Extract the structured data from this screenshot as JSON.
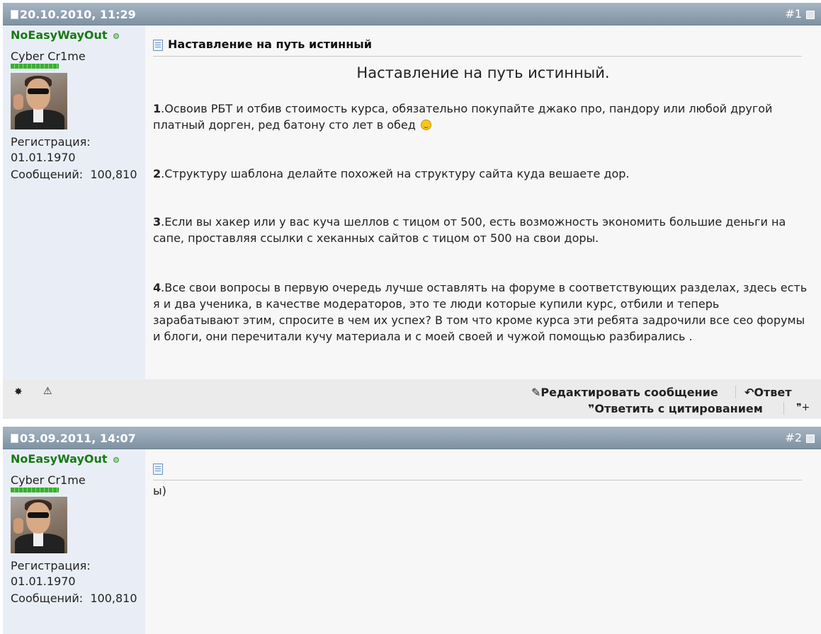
{
  "posts": [
    {
      "date": "20.10.2010, 11:29",
      "number": "#1",
      "user": {
        "name": "NoEasyWayOut",
        "title": "Cyber Cr1me",
        "reg_label": "Регистрация:",
        "reg_date": "01.01.1970",
        "posts_label": "Сообщений:",
        "posts_count": "100,810"
      },
      "title": "Наставление на путь истинный",
      "heading": "Наставление на путь истинный.",
      "paragraphs": [
        {
          "num": "1",
          "text": ".Освоив РБТ и отбив стоимость курса, обязательно покупайте джако про, пандору или любой другой платный дорген, ред батону сто лет в обед"
        },
        {
          "num": "2",
          "text": ".Структуру шаблона делайте похожей на структуру сайта куда вешаете дор."
        },
        {
          "num": "3",
          "text": ".Если вы хакер или у вас куча шеллов с тицом от 500, есть возможность экономить большие деньги на сапе, проставляя ссылки с хеканных сайтов с тицом от 500 на свои доры."
        },
        {
          "num": "4",
          "text": ".Все свои вопросы в первую очередь лучше оставлять на форуме в соответствующих разделах, здесь есть я и два ученика, в качестве модераторов, это те люди которые купили курс, отбили и теперь зарабатывают этим, спросите в чем их успех? В том что кроме курса эти ребята задрочили все сео форумы и блоги, они перечитали кучу материала и с моей своей и чужой помощью разбирались ."
        }
      ],
      "footer": {
        "edit_label": "Редактировать сообщение",
        "reply_label": "Ответ",
        "quote_label": "Ответить с цитированием"
      }
    },
    {
      "date": "03.09.2011, 14:07",
      "number": "#2",
      "user": {
        "name": "NoEasyWayOut",
        "title": "Cyber Cr1me",
        "reg_label": "Регистрация:",
        "reg_date": "01.01.1970",
        "posts_label": "Сообщений:",
        "posts_count": "100,810"
      },
      "text": "ы)"
    }
  ]
}
